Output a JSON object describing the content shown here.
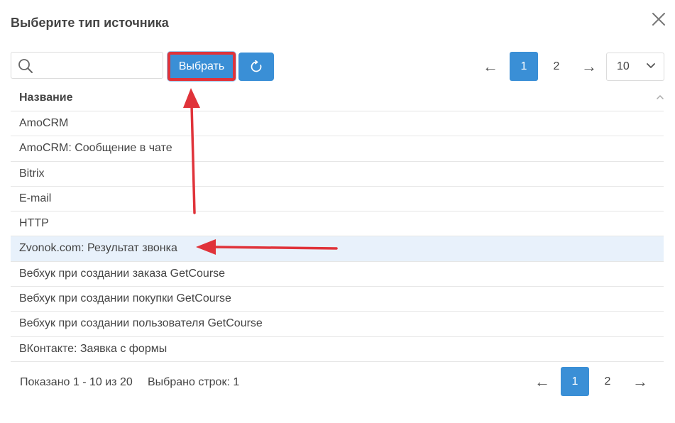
{
  "dialog": {
    "title": "Выберите тип источника",
    "close_icon": "close-icon"
  },
  "toolbar": {
    "search_placeholder": "",
    "search_value": "",
    "select_label": "Выбрать",
    "refresh_icon": "refresh-icon"
  },
  "pagination_top": {
    "prev": "←",
    "pages": [
      "1",
      "2"
    ],
    "active_page": "1",
    "next": "→",
    "page_size": "10"
  },
  "table": {
    "column_title": "Название",
    "rows": [
      "AmoCRM",
      "AmoCRM: Сообщение в чате",
      "Bitrix",
      "E-mail",
      "HTTP",
      "Zvonok.com: Результат звонка",
      "Вебхук при создании заказа GetCourse",
      "Вебхук при создании покупки GetCourse",
      "Вебхук при создании пользователя GetCourse",
      "ВКонтакте: Заявка с формы"
    ],
    "selected_row": "Zvonok.com: Результат звонка"
  },
  "footer": {
    "shown": "Показано 1 - 10 из 20",
    "selected": "Выбрано строк: 1",
    "prev": "←",
    "pages": [
      "1",
      "2"
    ],
    "active_page": "1",
    "next": "→"
  },
  "colors": {
    "accent": "#3a8fd6",
    "annotation": "#e0333a",
    "selected_row": "#e8f1fb"
  }
}
